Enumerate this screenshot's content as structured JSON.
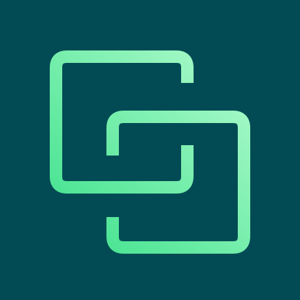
{
  "icon": {
    "name": "linked-squares-icon",
    "colors": {
      "background": "#034B54",
      "stroke_start": "#4FE596",
      "stroke_end": "#9DF7C2"
    }
  }
}
